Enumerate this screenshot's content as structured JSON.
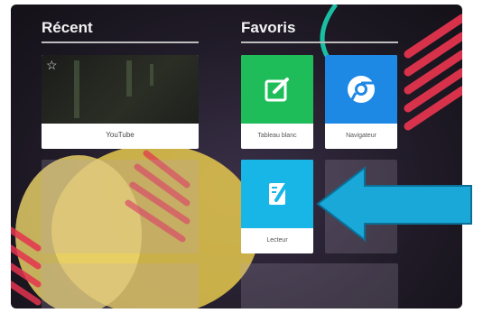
{
  "recent": {
    "title": "Récent",
    "items": [
      {
        "label": "YouTube",
        "starred": true
      }
    ]
  },
  "favorites": {
    "title": "Favoris",
    "items": [
      {
        "label": "Tableau blanc",
        "icon": "whiteboard-edit-icon",
        "color": "#1fbd5a"
      },
      {
        "label": "Navigateur",
        "icon": "chrome-browser-icon",
        "color": "#1e88e5"
      },
      {
        "label": "Lecteur",
        "icon": "reader-notebook-icon",
        "color": "#17b6e6"
      }
    ]
  },
  "annotation": {
    "arrow_color": "#19a8d8"
  }
}
